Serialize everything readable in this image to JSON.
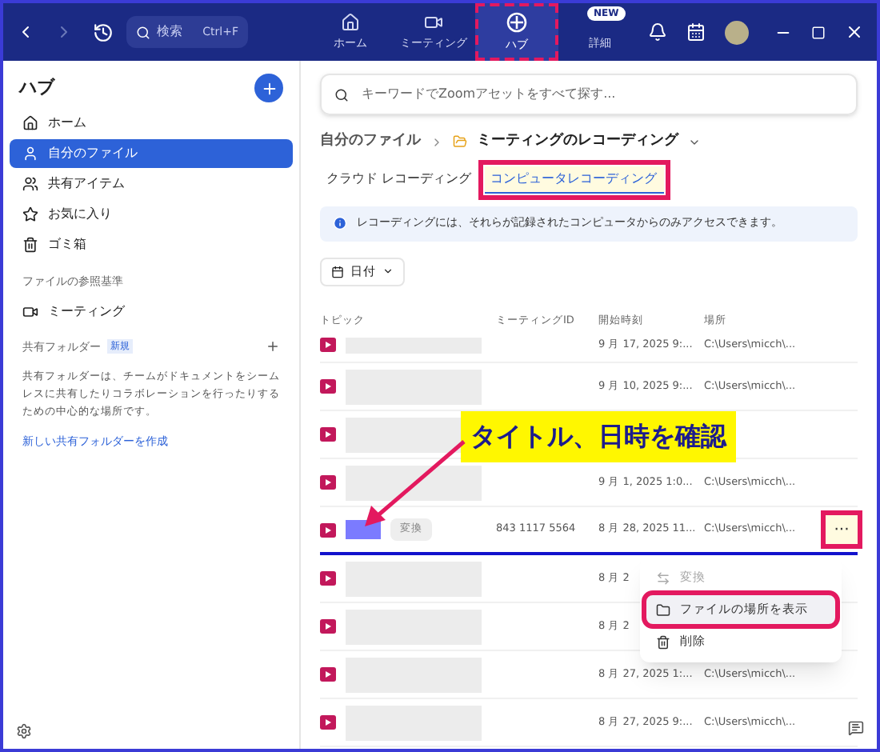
{
  "titlebar": {
    "search": {
      "placeholder": "検索",
      "shortcut": "Ctrl+F"
    },
    "tabs": [
      {
        "label": "ホーム",
        "selected": false,
        "highlighted": false
      },
      {
        "label": "ミーティング",
        "selected": false,
        "highlighted": false
      },
      {
        "label": "ハブ",
        "selected": true,
        "highlighted": true
      },
      {
        "label": "詳細",
        "selected": false,
        "highlighted": false,
        "badge": "NEW"
      }
    ]
  },
  "sidebar": {
    "title": "ハブ",
    "items": [
      {
        "label": "ホーム",
        "selected": false
      },
      {
        "label": "自分のファイル",
        "selected": true
      },
      {
        "label": "共有アイテム",
        "selected": false
      },
      {
        "label": "お気に入り",
        "selected": false
      },
      {
        "label": "ゴミ箱",
        "selected": false
      }
    ],
    "section_title": "ファイルの参照基準",
    "section_items": [
      {
        "label": "ミーティング",
        "selected": false
      }
    ],
    "shared_folders": {
      "title": "共有フォルダー",
      "badge": "新規",
      "description": "共有フォルダーは、チームがドキュメントをシームレスに共有したりコラボレーションを行ったりするための中心的な場所です。",
      "link": "新しい共有フォルダーを作成"
    }
  },
  "main": {
    "search": {
      "placeholder": "キーワードでZoomアセットをすべて探す..."
    },
    "breadcrumb": [
      "自分のファイル",
      "ミーティングのレコーディング"
    ],
    "tabs": [
      {
        "label": "クラウド レコーディング",
        "selected": false,
        "highlighted": false
      },
      {
        "label": "コンピュータレコーディング",
        "selected": true,
        "highlighted": true
      }
    ],
    "info": "レコーディングには、それらが記録されたコンピュータからのみアクセスできます。",
    "filter": "日付",
    "columns": [
      "トピック",
      "ミーティングID",
      "開始時刻",
      "場所"
    ],
    "rows": [
      {
        "kind": "blurred",
        "selected": false,
        "date": "9 月 17, 2025 9:...",
        "location": "C:\\Users\\micch\\..."
      },
      {
        "kind": "blurred",
        "selected": false,
        "date": "9 月 10, 2025 9:...",
        "location": "C:\\Users\\micch\\..."
      },
      {
        "kind": "blurred",
        "selected": false
      },
      {
        "kind": "blurred",
        "selected": false,
        "date": "9 月 1, 2025 1:0...",
        "location": "C:\\Users\\micch\\..."
      },
      {
        "kind": "marked",
        "selected": true,
        "chip": "変換",
        "meeting_id": "843 1117 5564",
        "date": "8 月 28, 2025 11...",
        "location": "C:\\Users\\micch\\...",
        "more": "···",
        "highlighted": true
      },
      {
        "kind": "blurred",
        "selected": false,
        "date": "8 月 2"
      },
      {
        "kind": "blurred",
        "selected": false,
        "date": "8 月 2"
      },
      {
        "kind": "blurred",
        "selected": false,
        "date": "8 月 27, 2025 1:...",
        "location": "C:\\Users\\micch\\..."
      },
      {
        "kind": "blurred",
        "selected": false,
        "date": "8 月 27, 2025 9:...",
        "location": "C:\\Users\\micch\\..."
      }
    ],
    "menu": [
      {
        "label": "変換",
        "disabled": true,
        "highlighted": false
      },
      {
        "label": "ファイルの場所を表示",
        "disabled": false,
        "highlighted": true
      },
      {
        "label": "削除",
        "disabled": false,
        "highlighted": false
      }
    ],
    "callout": "タイトル、日時を確認"
  }
}
